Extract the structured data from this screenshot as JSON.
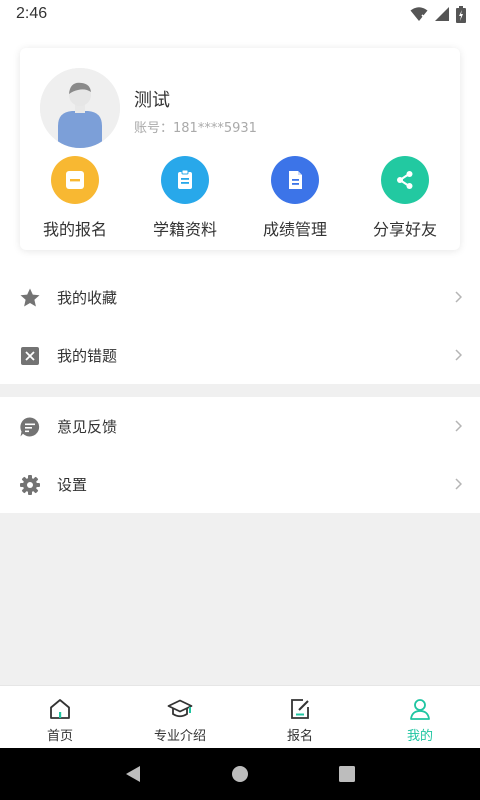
{
  "status_bar": {
    "time": "2:46"
  },
  "profile": {
    "name": "测试",
    "account": "账号：181****5931"
  },
  "quick_actions": [
    {
      "label": "我的报名",
      "icon": "minus-icon",
      "color": "#f8b832"
    },
    {
      "label": "学籍资料",
      "icon": "clipboard-icon",
      "color": "#28a8ea"
    },
    {
      "label": "成绩管理",
      "icon": "document-icon",
      "color": "#3c74e8"
    },
    {
      "label": "分享好友",
      "icon": "share-icon",
      "color": "#22c9a1"
    }
  ],
  "menu": {
    "group1": [
      {
        "label": "我的收藏",
        "icon": "star-icon"
      },
      {
        "label": "我的错题",
        "icon": "x-box-icon"
      }
    ],
    "group2": [
      {
        "label": "意见反馈",
        "icon": "chat-icon"
      },
      {
        "label": "设置",
        "icon": "gear-icon"
      }
    ]
  },
  "bottom_nav": [
    {
      "label": "首页",
      "icon": "home-icon",
      "active": false
    },
    {
      "label": "专业介绍",
      "icon": "graduation-cap-icon",
      "active": false
    },
    {
      "label": "报名",
      "icon": "edit-icon",
      "active": false
    },
    {
      "label": "我的",
      "icon": "person-icon",
      "active": true
    }
  ],
  "colors": {
    "accent": "#1fc5a1",
    "icon_gray": "#737373"
  }
}
